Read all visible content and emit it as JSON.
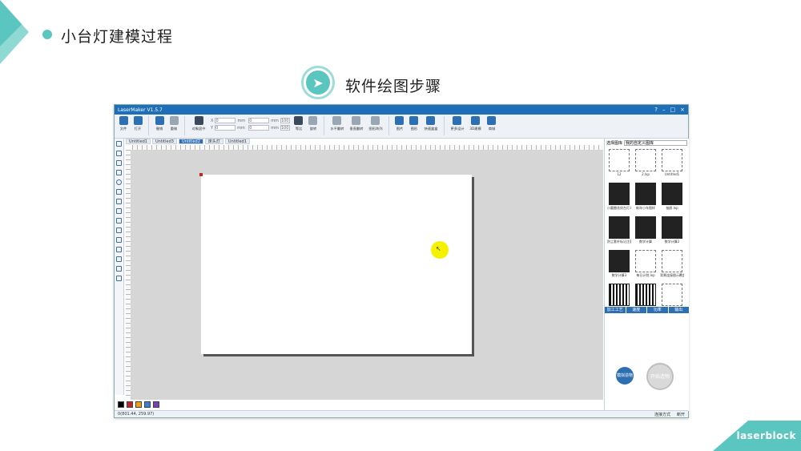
{
  "slide": {
    "title": "小台灯建模过程",
    "step_title": "软件绘图步骤",
    "brand": "laserblock",
    "accent_color": "#5bc6c0"
  },
  "app": {
    "title": "LaserMaker V1.5.7",
    "window_controls": [
      "?",
      "–",
      "□",
      "×"
    ],
    "toolbar": {
      "file": "文件",
      "open": "打开",
      "undo": "撤销",
      "redo": "重做",
      "align": "对象居中",
      "x_label": "X",
      "y_label": "Y",
      "x_val": "0",
      "y_val": "0",
      "w_val": "0",
      "h_val": "0",
      "unit": "mm",
      "pct": "100",
      "lock": "等比",
      "rotate": "旋转",
      "h_flip": "水平翻转",
      "v_flip": "垂直翻转",
      "shape_array": "图形阵列",
      "image": "图片",
      "shape_lib": "图形",
      "fast_box": "快速盒盒",
      "more_design": "更多设计",
      "modeling3d": "3D建模",
      "shop": "商城"
    },
    "tabs": [
      "Untitled1",
      "Untitled3",
      "Untitled2",
      "床头灯",
      "Untitled1"
    ],
    "active_tab_index": 2,
    "status": {
      "coords": "0(801.44, 259.97)",
      "connect_mode": "连接方式",
      "connection_state": "断开"
    },
    "colors": [
      "#000000",
      "#c0262b",
      "#e8a21b",
      "#3b7fd8",
      "#7b3fb5"
    ],
    "library": {
      "label": "选择图库",
      "selected": "我的自定义图库",
      "items": [
        {
          "cap": "12",
          "style": "dash"
        },
        {
          "cap": "2.lxp",
          "style": "dash"
        },
        {
          "cap": "Untitled1",
          "style": "dash"
        },
        {
          "cap": "小圆圈花纹台灯.lxp",
          "style": "bk"
        },
        {
          "cap": "新年小车图样",
          "style": "bk"
        },
        {
          "cap": "抽屉.lxp",
          "style": "bk"
        },
        {
          "cap": "防尘套杆标记注意事项提示",
          "style": "bk"
        },
        {
          "cap": "数学计算",
          "style": "bk"
        },
        {
          "cap": "数学计算2",
          "style": "bk"
        },
        {
          "cap": "数学计算3",
          "style": "bk"
        },
        {
          "cap": "每日计划.lxp",
          "style": "dash"
        },
        {
          "cap": "背景连接图示覆盖版",
          "style": "dash"
        },
        {
          "cap": "",
          "style": "pat"
        },
        {
          "cap": "",
          "style": "pat"
        },
        {
          "cap": "",
          "style": "dash"
        }
      ]
    },
    "process_headers": [
      "加工工艺",
      "速度",
      "功率",
      "输出"
    ],
    "simulate_label": "模拟造物",
    "start_label": "开始造物"
  }
}
